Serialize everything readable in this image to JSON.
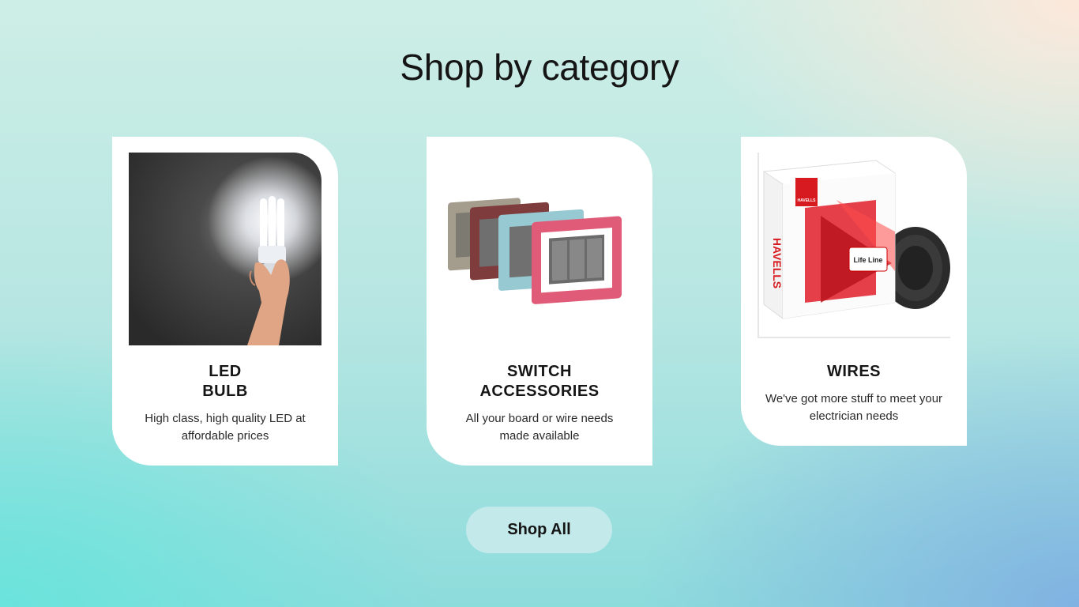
{
  "page": {
    "title": "Shop by category"
  },
  "categories": [
    {
      "title_line1": "LED",
      "title_line2": "BULB",
      "description": "High class, high quality LED at affordable prices",
      "image": "led-bulb-photo"
    },
    {
      "title_line1": "SWITCH",
      "title_line2": "ACCESSORIES",
      "description": "All your board or wire needs made available",
      "image": "switch-plates-photo"
    },
    {
      "title_line1": "WIRES",
      "description": "We've got more stuff to meet your electrician needs",
      "image": "wire-coil-box-photo",
      "brand_label": "HAVELLS",
      "product_label": "Life Line"
    }
  ],
  "cta": {
    "shop_all_label": "Shop All"
  }
}
